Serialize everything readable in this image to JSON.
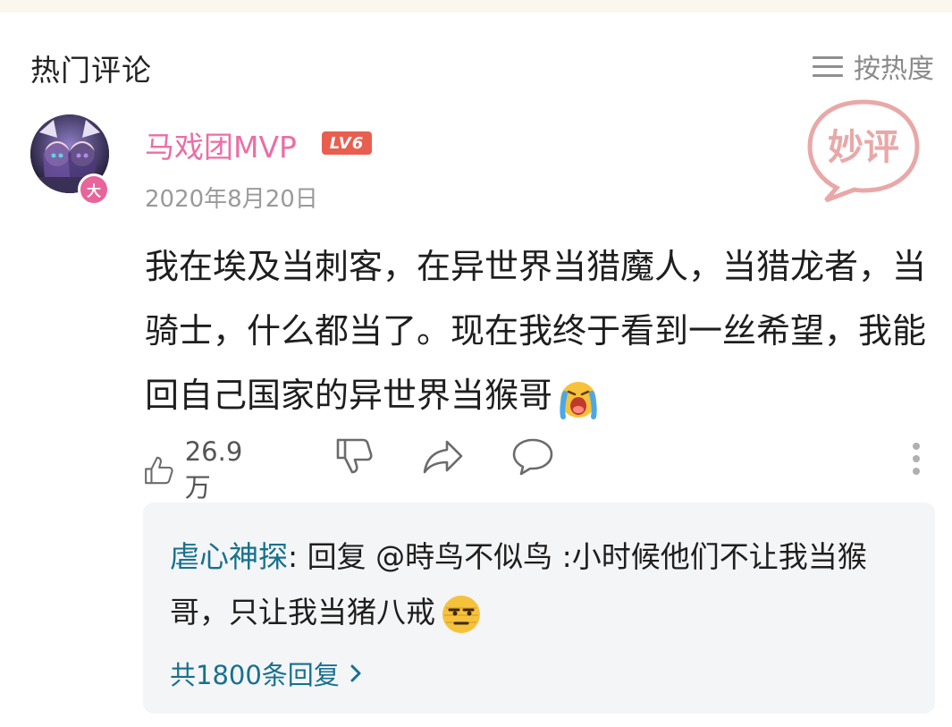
{
  "header": {
    "section_title": "热门评论",
    "sort_label": "按热度",
    "stamp_text": "妙评"
  },
  "comment": {
    "username": "马戏团MVP",
    "level": "LV6",
    "avatar_badge": "大",
    "date": "2020年8月20日",
    "text": "我在埃及当刺客，在异世界当猎魔人，当猎龙者，当骑士，什么都当了。现在我终于看到一丝希望，我能回自己国家的异世界当猴哥",
    "emoji": "crying-face-emoji",
    "likes": "26.9万"
  },
  "reply": {
    "author": "虐心神探",
    "colon": ": ",
    "text": "回复 @時鸟不似鸟 :小时候他们不让我当猴哥，只让我当猪八戒",
    "emoji": "meh-face-emoji",
    "more_label": "共1800条回复"
  },
  "colors": {
    "username": "#eb6ea6",
    "level_badge": "#e85f4f",
    "reply_author": "#17708f",
    "stamp": "#e9a8a8"
  }
}
